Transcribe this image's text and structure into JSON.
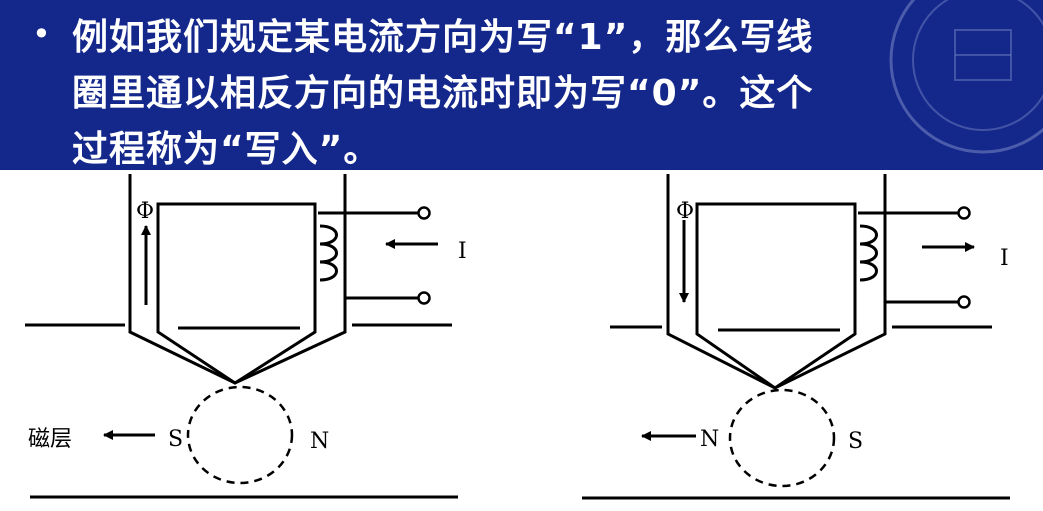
{
  "slide": {
    "bullet": "•",
    "text_lines": [
      "例如我们规定某电流方向为写“1”，那么写线",
      "圈里通以相反方向的电流时即为写“0”。这个",
      "过程称为“写入”。"
    ]
  },
  "diagram": {
    "left": {
      "flux_label": "Φ",
      "current_label": "I",
      "media_label": "磁层",
      "pole_left": "S",
      "pole_right": "N"
    },
    "right": {
      "flux_label": "Φ",
      "current_label": "I",
      "pole_left": "N",
      "pole_right": "S"
    }
  },
  "colors": {
    "banner": "#14288c",
    "text": "#ffffff",
    "line": "#000000"
  }
}
